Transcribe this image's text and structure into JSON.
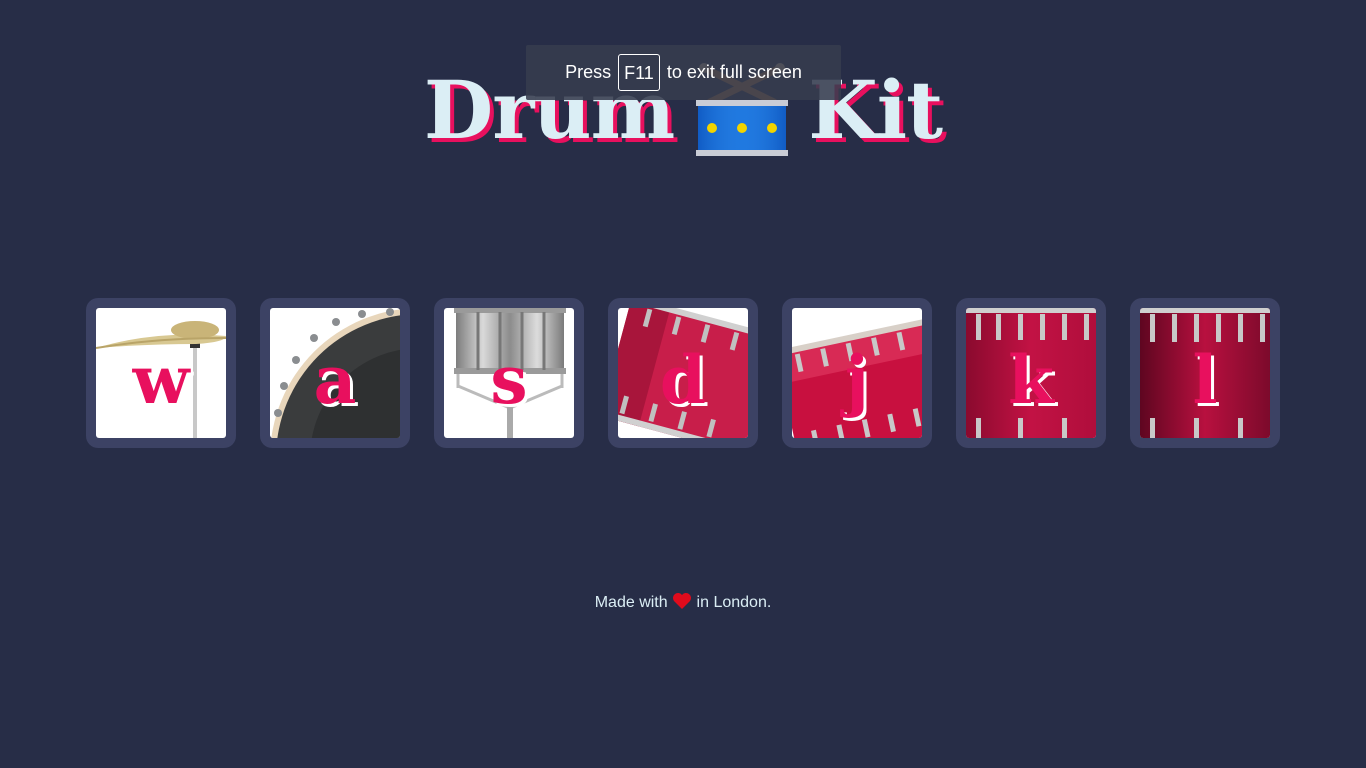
{
  "title": {
    "left_word": "Drum",
    "right_word": "Kit",
    "emoji_icon": "drum-with-sticks-icon"
  },
  "fullscreen_notice": {
    "prefix": "Press",
    "key": "F11",
    "suffix": "to exit full screen"
  },
  "keys": [
    {
      "letter": "w",
      "sound": "cymbal"
    },
    {
      "letter": "a",
      "sound": "bass-drum"
    },
    {
      "letter": "s",
      "sound": "snare"
    },
    {
      "letter": "d",
      "sound": "tom-1"
    },
    {
      "letter": "j",
      "sound": "tom-2"
    },
    {
      "letter": "k",
      "sound": "tom-3"
    },
    {
      "letter": "l",
      "sound": "floor-tom"
    }
  ],
  "footer": {
    "before": "Made with",
    "after": "in London.",
    "icon": "heart-icon"
  },
  "colors": {
    "background": "#272d47",
    "tile": "#3c4264",
    "accent": "#e8105e",
    "title_text": "#dbeef5"
  }
}
